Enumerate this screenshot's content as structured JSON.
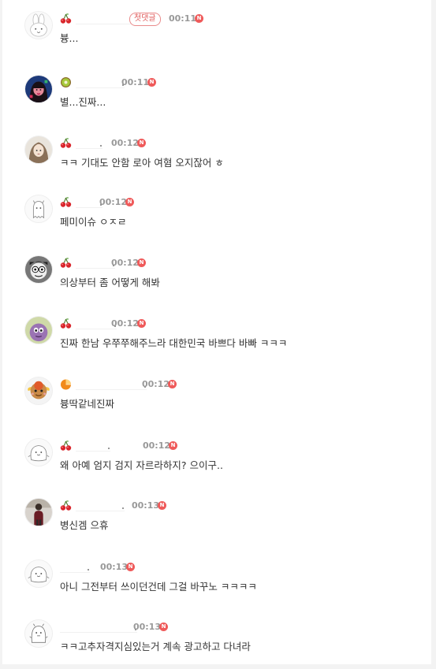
{
  "comments": [
    {
      "level": "cherry",
      "time": "00:11",
      "badge": "첫댓글",
      "new": "N",
      "text": "븅...",
      "avatar": "rabbit"
    },
    {
      "level": "kiwi",
      "time": "00:11",
      "new": "N",
      "text": "별...진짜...",
      "avatar": "girl"
    },
    {
      "level": "cherry",
      "time": "00:12",
      "new": "N",
      "text": "ㅋㅋ 기대도 안함 로아 여혐 오지잖어 ㅎ",
      "avatar": "anime"
    },
    {
      "level": "cherry",
      "time": "00:12",
      "new": "N",
      "text": "페미이슈 ㅇㅈㄹ",
      "avatar": "ghost"
    },
    {
      "level": "cherry",
      "time": "00:12",
      "new": "N",
      "text": "의상부터 좀 어떻게 해봐",
      "avatar": "bw"
    },
    {
      "level": "cherry",
      "time": "00:12",
      "new": "N",
      "text": "진짜 한남 우쭈쭈해주느라 대한민국 바쁘다 바빠 ㅋㅋㅋ",
      "avatar": "purple"
    },
    {
      "level": "orange",
      "time": "00:12",
      "new": "N",
      "text": "븅딱같네진짜",
      "avatar": "cookie"
    },
    {
      "level": "cherry",
      "time": "00:12",
      "new": "N",
      "text": "왜 아예 엄지 검지 자르라하지? 으이구..",
      "avatar": "blob"
    },
    {
      "level": "cherry",
      "time": "00:13",
      "new": "N",
      "text": "병신겜 으휴",
      "avatar": "person"
    },
    {
      "level": "none",
      "time": "00:13",
      "new": "N",
      "text": "아니 그전부터 쓰이던건데 그걸 바꾸노 ㅋㅋㅋㅋ",
      "avatar": "blob"
    },
    {
      "level": "none",
      "time": "00:13",
      "new": "N",
      "text": "ㅋㅋ고추자격지심있는거 계속 광고하고 다녀라",
      "avatar": "penguin"
    }
  ],
  "colors": {
    "cherry": "#d9262c",
    "new_badge": "#ef5a5a",
    "first_badge": "#e05b5b",
    "time": "#999999"
  }
}
